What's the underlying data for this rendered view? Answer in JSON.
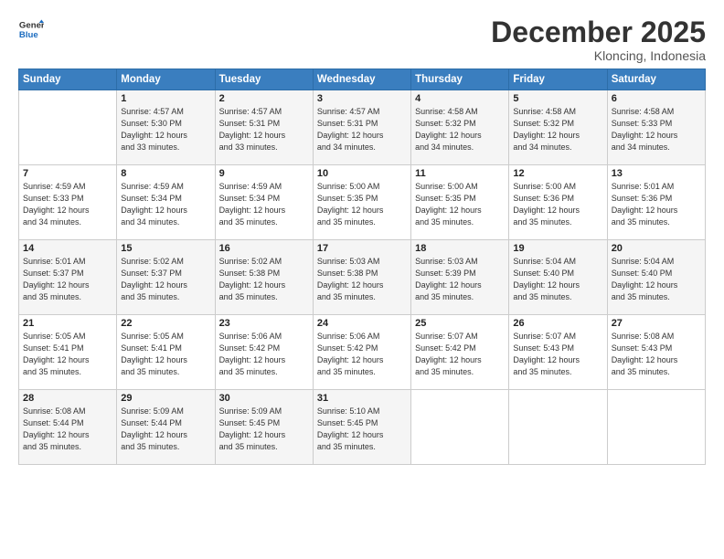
{
  "logo": {
    "line1": "General",
    "line2": "Blue"
  },
  "title": "December 2025",
  "location": "Kloncing, Indonesia",
  "header": {
    "days": [
      "Sunday",
      "Monday",
      "Tuesday",
      "Wednesday",
      "Thursday",
      "Friday",
      "Saturday"
    ]
  },
  "weeks": [
    [
      {
        "day": "",
        "info": ""
      },
      {
        "day": "1",
        "info": "Sunrise: 4:57 AM\nSunset: 5:30 PM\nDaylight: 12 hours\nand 33 minutes."
      },
      {
        "day": "2",
        "info": "Sunrise: 4:57 AM\nSunset: 5:31 PM\nDaylight: 12 hours\nand 33 minutes."
      },
      {
        "day": "3",
        "info": "Sunrise: 4:57 AM\nSunset: 5:31 PM\nDaylight: 12 hours\nand 34 minutes."
      },
      {
        "day": "4",
        "info": "Sunrise: 4:58 AM\nSunset: 5:32 PM\nDaylight: 12 hours\nand 34 minutes."
      },
      {
        "day": "5",
        "info": "Sunrise: 4:58 AM\nSunset: 5:32 PM\nDaylight: 12 hours\nand 34 minutes."
      },
      {
        "day": "6",
        "info": "Sunrise: 4:58 AM\nSunset: 5:33 PM\nDaylight: 12 hours\nand 34 minutes."
      }
    ],
    [
      {
        "day": "7",
        "info": "Sunrise: 4:59 AM\nSunset: 5:33 PM\nDaylight: 12 hours\nand 34 minutes."
      },
      {
        "day": "8",
        "info": "Sunrise: 4:59 AM\nSunset: 5:34 PM\nDaylight: 12 hours\nand 34 minutes."
      },
      {
        "day": "9",
        "info": "Sunrise: 4:59 AM\nSunset: 5:34 PM\nDaylight: 12 hours\nand 35 minutes."
      },
      {
        "day": "10",
        "info": "Sunrise: 5:00 AM\nSunset: 5:35 PM\nDaylight: 12 hours\nand 35 minutes."
      },
      {
        "day": "11",
        "info": "Sunrise: 5:00 AM\nSunset: 5:35 PM\nDaylight: 12 hours\nand 35 minutes."
      },
      {
        "day": "12",
        "info": "Sunrise: 5:00 AM\nSunset: 5:36 PM\nDaylight: 12 hours\nand 35 minutes."
      },
      {
        "day": "13",
        "info": "Sunrise: 5:01 AM\nSunset: 5:36 PM\nDaylight: 12 hours\nand 35 minutes."
      }
    ],
    [
      {
        "day": "14",
        "info": "Sunrise: 5:01 AM\nSunset: 5:37 PM\nDaylight: 12 hours\nand 35 minutes."
      },
      {
        "day": "15",
        "info": "Sunrise: 5:02 AM\nSunset: 5:37 PM\nDaylight: 12 hours\nand 35 minutes."
      },
      {
        "day": "16",
        "info": "Sunrise: 5:02 AM\nSunset: 5:38 PM\nDaylight: 12 hours\nand 35 minutes."
      },
      {
        "day": "17",
        "info": "Sunrise: 5:03 AM\nSunset: 5:38 PM\nDaylight: 12 hours\nand 35 minutes."
      },
      {
        "day": "18",
        "info": "Sunrise: 5:03 AM\nSunset: 5:39 PM\nDaylight: 12 hours\nand 35 minutes."
      },
      {
        "day": "19",
        "info": "Sunrise: 5:04 AM\nSunset: 5:40 PM\nDaylight: 12 hours\nand 35 minutes."
      },
      {
        "day": "20",
        "info": "Sunrise: 5:04 AM\nSunset: 5:40 PM\nDaylight: 12 hours\nand 35 minutes."
      }
    ],
    [
      {
        "day": "21",
        "info": "Sunrise: 5:05 AM\nSunset: 5:41 PM\nDaylight: 12 hours\nand 35 minutes."
      },
      {
        "day": "22",
        "info": "Sunrise: 5:05 AM\nSunset: 5:41 PM\nDaylight: 12 hours\nand 35 minutes."
      },
      {
        "day": "23",
        "info": "Sunrise: 5:06 AM\nSunset: 5:42 PM\nDaylight: 12 hours\nand 35 minutes."
      },
      {
        "day": "24",
        "info": "Sunrise: 5:06 AM\nSunset: 5:42 PM\nDaylight: 12 hours\nand 35 minutes."
      },
      {
        "day": "25",
        "info": "Sunrise: 5:07 AM\nSunset: 5:42 PM\nDaylight: 12 hours\nand 35 minutes."
      },
      {
        "day": "26",
        "info": "Sunrise: 5:07 AM\nSunset: 5:43 PM\nDaylight: 12 hours\nand 35 minutes."
      },
      {
        "day": "27",
        "info": "Sunrise: 5:08 AM\nSunset: 5:43 PM\nDaylight: 12 hours\nand 35 minutes."
      }
    ],
    [
      {
        "day": "28",
        "info": "Sunrise: 5:08 AM\nSunset: 5:44 PM\nDaylight: 12 hours\nand 35 minutes."
      },
      {
        "day": "29",
        "info": "Sunrise: 5:09 AM\nSunset: 5:44 PM\nDaylight: 12 hours\nand 35 minutes."
      },
      {
        "day": "30",
        "info": "Sunrise: 5:09 AM\nSunset: 5:45 PM\nDaylight: 12 hours\nand 35 minutes."
      },
      {
        "day": "31",
        "info": "Sunrise: 5:10 AM\nSunset: 5:45 PM\nDaylight: 12 hours\nand 35 minutes."
      },
      {
        "day": "",
        "info": ""
      },
      {
        "day": "",
        "info": ""
      },
      {
        "day": "",
        "info": ""
      }
    ]
  ]
}
